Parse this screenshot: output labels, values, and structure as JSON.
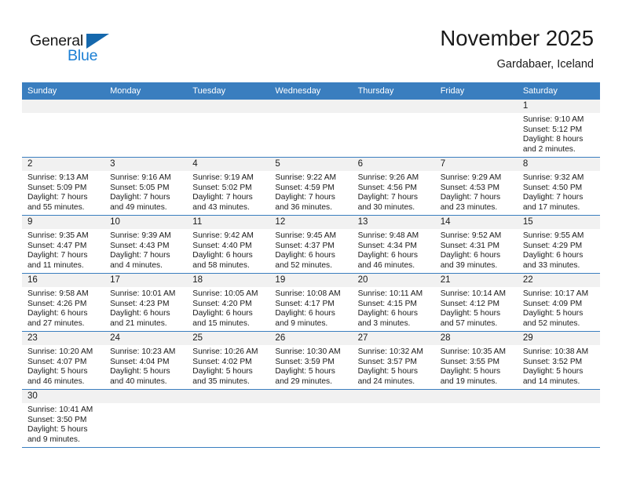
{
  "brand": {
    "name_top": "General",
    "name_bottom": "Blue",
    "accent_color": "#1568ad",
    "blue_text_color": "#1b7fd4"
  },
  "header": {
    "title": "November 2025",
    "subtitle": "Gardabaer, Iceland"
  },
  "theme": {
    "header_row_bg": "#3a7ebf",
    "daynum_bg": "#f1f1f1",
    "row_divider": "#3a7ebf"
  },
  "weekdays": [
    "Sunday",
    "Monday",
    "Tuesday",
    "Wednesday",
    "Thursday",
    "Friday",
    "Saturday"
  ],
  "labels": {
    "sunrise": "Sunrise:",
    "sunset": "Sunset:",
    "daylight": "Daylight:"
  },
  "weeks": [
    [
      {
        "day": ""
      },
      {
        "day": ""
      },
      {
        "day": ""
      },
      {
        "day": ""
      },
      {
        "day": ""
      },
      {
        "day": ""
      },
      {
        "day": "1",
        "sunrise": "Sunrise: 9:10 AM",
        "sunset": "Sunset: 5:12 PM",
        "daylight_1": "Daylight: 8 hours",
        "daylight_2": "and 2 minutes."
      }
    ],
    [
      {
        "day": "2",
        "sunrise": "Sunrise: 9:13 AM",
        "sunset": "Sunset: 5:09 PM",
        "daylight_1": "Daylight: 7 hours",
        "daylight_2": "and 55 minutes."
      },
      {
        "day": "3",
        "sunrise": "Sunrise: 9:16 AM",
        "sunset": "Sunset: 5:05 PM",
        "daylight_1": "Daylight: 7 hours",
        "daylight_2": "and 49 minutes."
      },
      {
        "day": "4",
        "sunrise": "Sunrise: 9:19 AM",
        "sunset": "Sunset: 5:02 PM",
        "daylight_1": "Daylight: 7 hours",
        "daylight_2": "and 43 minutes."
      },
      {
        "day": "5",
        "sunrise": "Sunrise: 9:22 AM",
        "sunset": "Sunset: 4:59 PM",
        "daylight_1": "Daylight: 7 hours",
        "daylight_2": "and 36 minutes."
      },
      {
        "day": "6",
        "sunrise": "Sunrise: 9:26 AM",
        "sunset": "Sunset: 4:56 PM",
        "daylight_1": "Daylight: 7 hours",
        "daylight_2": "and 30 minutes."
      },
      {
        "day": "7",
        "sunrise": "Sunrise: 9:29 AM",
        "sunset": "Sunset: 4:53 PM",
        "daylight_1": "Daylight: 7 hours",
        "daylight_2": "and 23 minutes."
      },
      {
        "day": "8",
        "sunrise": "Sunrise: 9:32 AM",
        "sunset": "Sunset: 4:50 PM",
        "daylight_1": "Daylight: 7 hours",
        "daylight_2": "and 17 minutes."
      }
    ],
    [
      {
        "day": "9",
        "sunrise": "Sunrise: 9:35 AM",
        "sunset": "Sunset: 4:47 PM",
        "daylight_1": "Daylight: 7 hours",
        "daylight_2": "and 11 minutes."
      },
      {
        "day": "10",
        "sunrise": "Sunrise: 9:39 AM",
        "sunset": "Sunset: 4:43 PM",
        "daylight_1": "Daylight: 7 hours",
        "daylight_2": "and 4 minutes."
      },
      {
        "day": "11",
        "sunrise": "Sunrise: 9:42 AM",
        "sunset": "Sunset: 4:40 PM",
        "daylight_1": "Daylight: 6 hours",
        "daylight_2": "and 58 minutes."
      },
      {
        "day": "12",
        "sunrise": "Sunrise: 9:45 AM",
        "sunset": "Sunset: 4:37 PM",
        "daylight_1": "Daylight: 6 hours",
        "daylight_2": "and 52 minutes."
      },
      {
        "day": "13",
        "sunrise": "Sunrise: 9:48 AM",
        "sunset": "Sunset: 4:34 PM",
        "daylight_1": "Daylight: 6 hours",
        "daylight_2": "and 46 minutes."
      },
      {
        "day": "14",
        "sunrise": "Sunrise: 9:52 AM",
        "sunset": "Sunset: 4:31 PM",
        "daylight_1": "Daylight: 6 hours",
        "daylight_2": "and 39 minutes."
      },
      {
        "day": "15",
        "sunrise": "Sunrise: 9:55 AM",
        "sunset": "Sunset: 4:29 PM",
        "daylight_1": "Daylight: 6 hours",
        "daylight_2": "and 33 minutes."
      }
    ],
    [
      {
        "day": "16",
        "sunrise": "Sunrise: 9:58 AM",
        "sunset": "Sunset: 4:26 PM",
        "daylight_1": "Daylight: 6 hours",
        "daylight_2": "and 27 minutes."
      },
      {
        "day": "17",
        "sunrise": "Sunrise: 10:01 AM",
        "sunset": "Sunset: 4:23 PM",
        "daylight_1": "Daylight: 6 hours",
        "daylight_2": "and 21 minutes."
      },
      {
        "day": "18",
        "sunrise": "Sunrise: 10:05 AM",
        "sunset": "Sunset: 4:20 PM",
        "daylight_1": "Daylight: 6 hours",
        "daylight_2": "and 15 minutes."
      },
      {
        "day": "19",
        "sunrise": "Sunrise: 10:08 AM",
        "sunset": "Sunset: 4:17 PM",
        "daylight_1": "Daylight: 6 hours",
        "daylight_2": "and 9 minutes."
      },
      {
        "day": "20",
        "sunrise": "Sunrise: 10:11 AM",
        "sunset": "Sunset: 4:15 PM",
        "daylight_1": "Daylight: 6 hours",
        "daylight_2": "and 3 minutes."
      },
      {
        "day": "21",
        "sunrise": "Sunrise: 10:14 AM",
        "sunset": "Sunset: 4:12 PM",
        "daylight_1": "Daylight: 5 hours",
        "daylight_2": "and 57 minutes."
      },
      {
        "day": "22",
        "sunrise": "Sunrise: 10:17 AM",
        "sunset": "Sunset: 4:09 PM",
        "daylight_1": "Daylight: 5 hours",
        "daylight_2": "and 52 minutes."
      }
    ],
    [
      {
        "day": "23",
        "sunrise": "Sunrise: 10:20 AM",
        "sunset": "Sunset: 4:07 PM",
        "daylight_1": "Daylight: 5 hours",
        "daylight_2": "and 46 minutes."
      },
      {
        "day": "24",
        "sunrise": "Sunrise: 10:23 AM",
        "sunset": "Sunset: 4:04 PM",
        "daylight_1": "Daylight: 5 hours",
        "daylight_2": "and 40 minutes."
      },
      {
        "day": "25",
        "sunrise": "Sunrise: 10:26 AM",
        "sunset": "Sunset: 4:02 PM",
        "daylight_1": "Daylight: 5 hours",
        "daylight_2": "and 35 minutes."
      },
      {
        "day": "26",
        "sunrise": "Sunrise: 10:30 AM",
        "sunset": "Sunset: 3:59 PM",
        "daylight_1": "Daylight: 5 hours",
        "daylight_2": "and 29 minutes."
      },
      {
        "day": "27",
        "sunrise": "Sunrise: 10:32 AM",
        "sunset": "Sunset: 3:57 PM",
        "daylight_1": "Daylight: 5 hours",
        "daylight_2": "and 24 minutes."
      },
      {
        "day": "28",
        "sunrise": "Sunrise: 10:35 AM",
        "sunset": "Sunset: 3:55 PM",
        "daylight_1": "Daylight: 5 hours",
        "daylight_2": "and 19 minutes."
      },
      {
        "day": "29",
        "sunrise": "Sunrise: 10:38 AM",
        "sunset": "Sunset: 3:52 PM",
        "daylight_1": "Daylight: 5 hours",
        "daylight_2": "and 14 minutes."
      }
    ],
    [
      {
        "day": "30",
        "sunrise": "Sunrise: 10:41 AM",
        "sunset": "Sunset: 3:50 PM",
        "daylight_1": "Daylight: 5 hours",
        "daylight_2": "and 9 minutes."
      },
      {
        "day": ""
      },
      {
        "day": ""
      },
      {
        "day": ""
      },
      {
        "day": ""
      },
      {
        "day": ""
      },
      {
        "day": ""
      }
    ]
  ]
}
